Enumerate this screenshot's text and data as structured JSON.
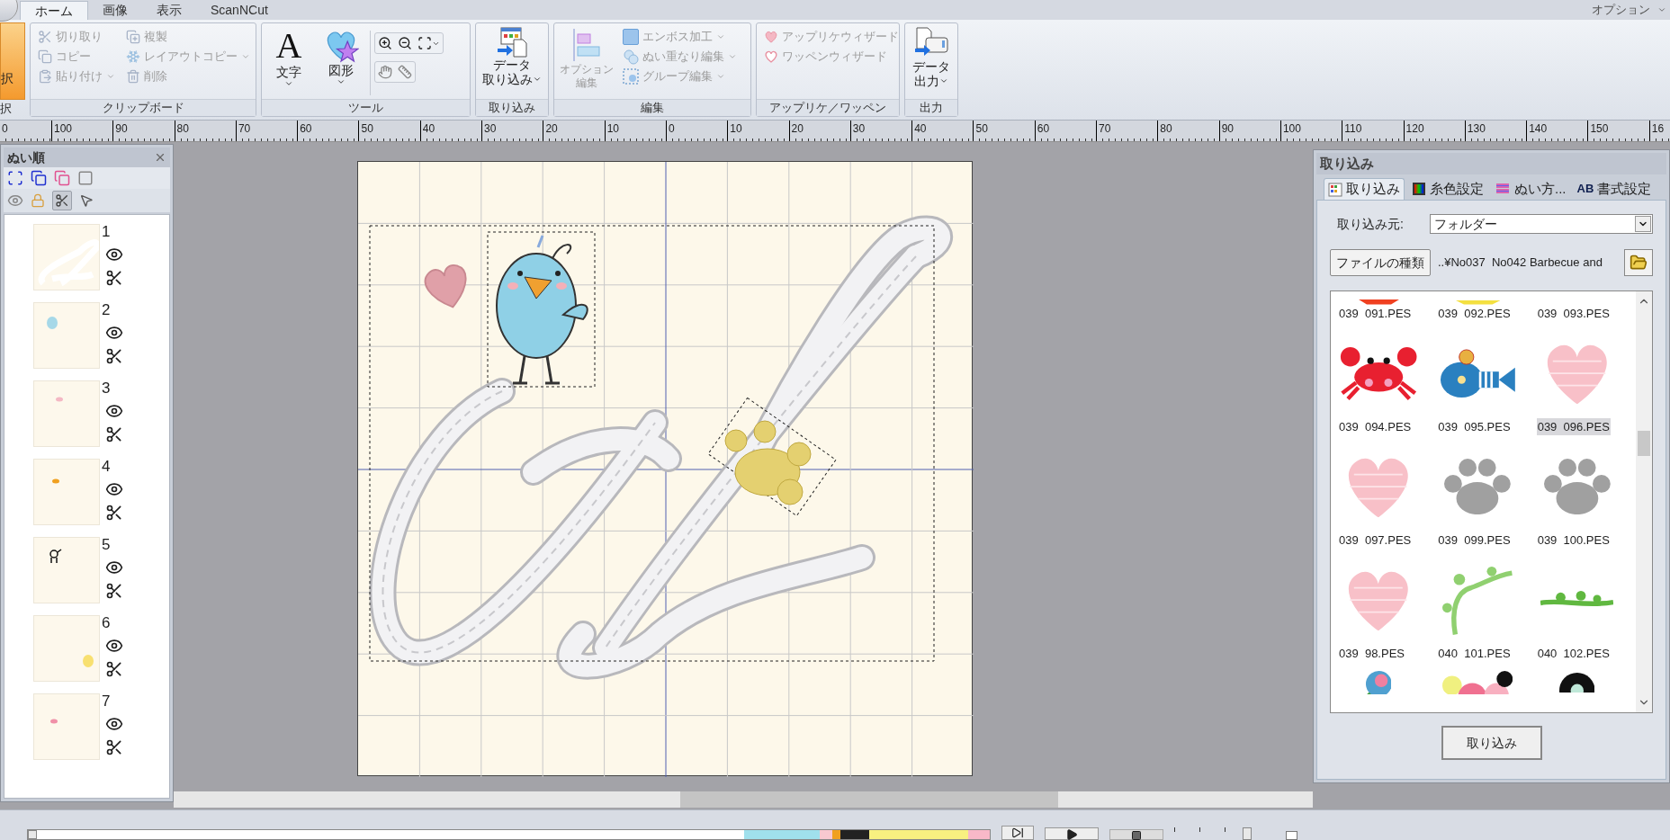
{
  "menu_tabs": [
    {
      "label": "ホーム",
      "selected": true
    },
    {
      "label": "画像",
      "selected": false
    },
    {
      "label": "表示",
      "selected": false
    },
    {
      "label": "ScanNCut",
      "selected": false
    }
  ],
  "options_menu": {
    "label": "オプション"
  },
  "ribbon": {
    "select": {
      "label": "択",
      "title": "択",
      "selected": true
    },
    "clipboard": {
      "title": "クリップボード",
      "disabled": true,
      "cut": "切り取り",
      "duplicate": "複製",
      "copy": "コピー",
      "layout_copy": "レイアウトコピー",
      "paste": "貼り付け",
      "delete": "削除"
    },
    "tools": {
      "title": "ツール",
      "text_icon": "A",
      "text": "文字",
      "shape": "図形"
    },
    "import": {
      "title": "取り込み",
      "lines": [
        "データ",
        "取り込み"
      ]
    },
    "edit": {
      "title": "編集",
      "disabled": true,
      "option_lines": [
        "オプション",
        "編集"
      ],
      "emboss": "エンボス加工",
      "overlap": "ぬい重なり編集",
      "group": "グループ編集"
    },
    "applique": {
      "title": "アップリケ／ワッペン",
      "disabled": true,
      "applique_wizard": "アップリケウィザード",
      "patch_wizard": "ワッペンウィザード"
    },
    "output": {
      "title": "出力",
      "lines": [
        "データ",
        "出力"
      ]
    }
  },
  "ruler": [
    "0",
    "100",
    "90",
    "80",
    "70",
    "60",
    "50",
    "40",
    "30",
    "20",
    "10",
    "0",
    "10",
    "20",
    "30",
    "40",
    "50",
    "60",
    "70",
    "80",
    "90",
    "100",
    "110",
    "120",
    "130",
    "140",
    "150",
    "16"
  ],
  "sewing_order": {
    "title": "ぬい順",
    "scissors_pressed": true,
    "items": [
      {
        "number": "1",
        "kind": "letter"
      },
      {
        "number": "2",
        "kind": "blob",
        "color": "#a6d8e8"
      },
      {
        "number": "3",
        "kind": "dot",
        "color": "#f4b8c4"
      },
      {
        "number": "4",
        "kind": "dot",
        "color": "#f0a020"
      },
      {
        "number": "5",
        "kind": "figure"
      },
      {
        "number": "6",
        "kind": "blob",
        "color": "#f8e070"
      },
      {
        "number": "7",
        "kind": "dot",
        "color": "#f090a8"
      }
    ]
  },
  "import_panel": {
    "title": "取り込み",
    "tabs": [
      {
        "label": "取り込み",
        "kind": "grid",
        "selected": true
      },
      {
        "label": "糸色設定",
        "kind": "spool",
        "selected": false
      },
      {
        "label": "ぬい方...",
        "kind": "stripes",
        "selected": false
      },
      {
        "label": "書式設定",
        "kind": "text",
        "badge": "AB",
        "selected": false
      }
    ],
    "source_label": "取り込み元:",
    "source_value": "フォルダー",
    "file_type_button": "ファイルの種類",
    "path": "..¥No037  No042 Barbecue and",
    "files": [
      {
        "label": "039  091.PES",
        "kind": "redsliver",
        "selected": false
      },
      {
        "label": "039  092.PES",
        "kind": "yellowsliver",
        "selected": false
      },
      {
        "label": "039  093.PES",
        "kind": "blank",
        "selected": false
      },
      {
        "label": "039  094.PES",
        "kind": "crab",
        "selected": false
      },
      {
        "label": "039  095.PES",
        "kind": "fish",
        "selected": false
      },
      {
        "label": "039  096.PES",
        "kind": "heart",
        "selected": true
      },
      {
        "label": "039  097.PES",
        "kind": "heart",
        "selected": false
      },
      {
        "label": "039  099.PES",
        "kind": "paw",
        "selected": false
      },
      {
        "label": "039  100.PES",
        "kind": "paw",
        "selected": false
      },
      {
        "label": "039  98.PES",
        "kind": "heart",
        "selected": false
      },
      {
        "label": "040  101.PES",
        "kind": "vine",
        "selected": false
      },
      {
        "label": "040  102.PES",
        "kind": "branch",
        "selected": false
      },
      {
        "kind": "carnation",
        "selected": false
      },
      {
        "kind": "bouquet",
        "selected": false
      },
      {
        "kind": "blackflower",
        "selected": false
      }
    ],
    "import_button": "取り込み"
  },
  "stitch_slider": {
    "level": 0.0
  },
  "speed_slider": {
    "level": 0.72
  },
  "auto_checkbox": {
    "checked": false
  }
}
